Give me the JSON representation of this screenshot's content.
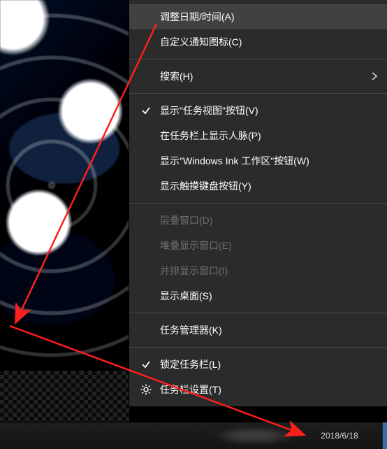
{
  "menu": {
    "items": [
      {
        "label": "调整日期/时间(A)",
        "hover": true
      },
      {
        "label": "自定义通知图标(C)"
      },
      {
        "sep": true
      },
      {
        "label": "搜索(H)",
        "submenu": true
      },
      {
        "sep": true
      },
      {
        "label": "显示\"任务视图\"按钮(V)",
        "checked": true
      },
      {
        "label": "在任务栏上显示人脉(P)"
      },
      {
        "label": "显示\"Windows Ink 工作区\"按钮(W)"
      },
      {
        "label": "显示触摸键盘按钮(Y)"
      },
      {
        "sep": true
      },
      {
        "label": "层叠窗口(D)",
        "disabled": true
      },
      {
        "label": "堆叠显示窗口(E)",
        "disabled": true
      },
      {
        "label": "并排显示窗口(I)",
        "disabled": true
      },
      {
        "label": "显示桌面(S)"
      },
      {
        "sep": true
      },
      {
        "label": "任务管理器(K)"
      },
      {
        "sep": true
      },
      {
        "label": "锁定任务栏(L)",
        "checked": true
      },
      {
        "label": "任务栏设置(T)",
        "icon": "gear"
      }
    ]
  },
  "taskbar": {
    "date": "2018/6/18"
  }
}
